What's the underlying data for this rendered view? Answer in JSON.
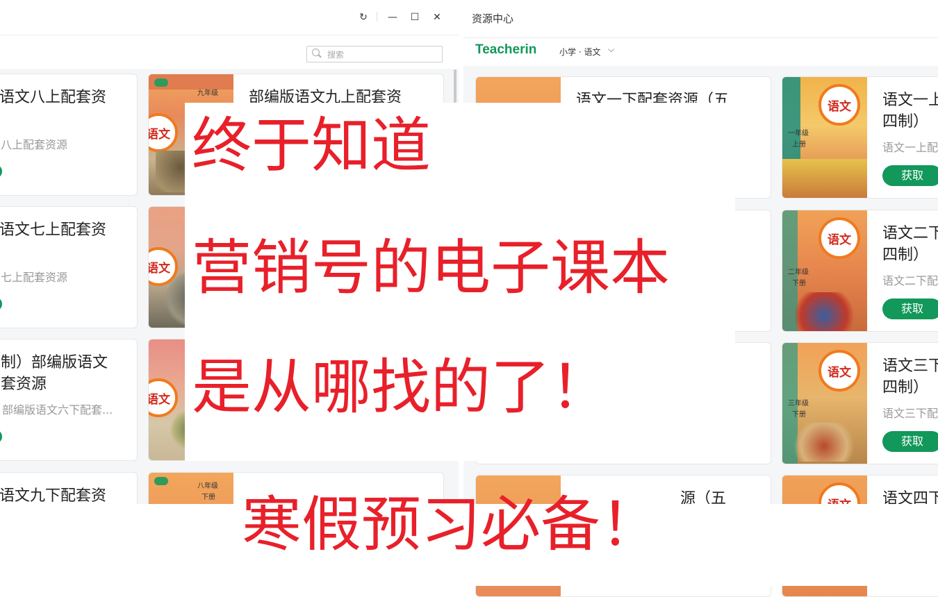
{
  "left_window": {
    "controls": {
      "refresh": "↻",
      "minimize": "—",
      "maximize": "☐",
      "close": "✕"
    },
    "search": {
      "placeholder": "搜索"
    },
    "cards": [
      {
        "title_line1": "语文八上配套资",
        "title_line2": "",
        "subtitle": "八上配套资源"
      },
      {
        "title_line1": "语文七上配套资",
        "title_line2": "",
        "subtitle": "七上配套资源"
      },
      {
        "title_line1": "制）部编版语文",
        "title_line2": "套资源",
        "subtitle": "部编版语文六下配套..."
      },
      {
        "title_line1": "语文九下配套资",
        "title_line2": "",
        "subtitle": ""
      }
    ],
    "covers": [
      {
        "grade": "九年级",
        "logo": "语文"
      },
      {
        "grade": "",
        "logo": "语文"
      },
      {
        "grade": "",
        "logo": "语文"
      },
      {
        "grade": "八年级",
        "grade2": "下册",
        "logo": "语文"
      }
    ],
    "card_partial_title": "部编版语文九上配套资"
  },
  "right_window": {
    "title": "资源中心",
    "brand": "Teacherin",
    "level_select": "小学 · 语文",
    "cards": [
      {
        "title": "语文一下配套资源（五"
      },
      {
        "title": ""
      },
      {
        "title": ""
      },
      {
        "title": "源（五"
      }
    ],
    "cards_right": [
      {
        "title_line1": "语文一上",
        "title_line2": "四制）",
        "subtitle": "语文一上配",
        "button": "获取",
        "grade": "一年级",
        "volume": "上册"
      },
      {
        "title_line1": "语文二下",
        "title_line2": "四制）",
        "subtitle": "语文二下配",
        "button": "获取",
        "grade": "二年级",
        "volume": "下册"
      },
      {
        "title_line1": "语文三下",
        "title_line2": "四制）",
        "subtitle": "语文三下配",
        "button": "获取",
        "grade": "三年级",
        "volume": "下册"
      },
      {
        "title_line1": "语文四下",
        "title_line2": "",
        "subtitle": "",
        "button": "",
        "grade": "",
        "volume": ""
      }
    ]
  },
  "overlay": {
    "line1": "终于知道",
    "line2": "营销号的电子课本",
    "line3": "是从哪找的了！",
    "line4": "寒假预习必备！"
  },
  "colors": {
    "accent_green": "#11985a",
    "caption_red": "#e8202a"
  }
}
